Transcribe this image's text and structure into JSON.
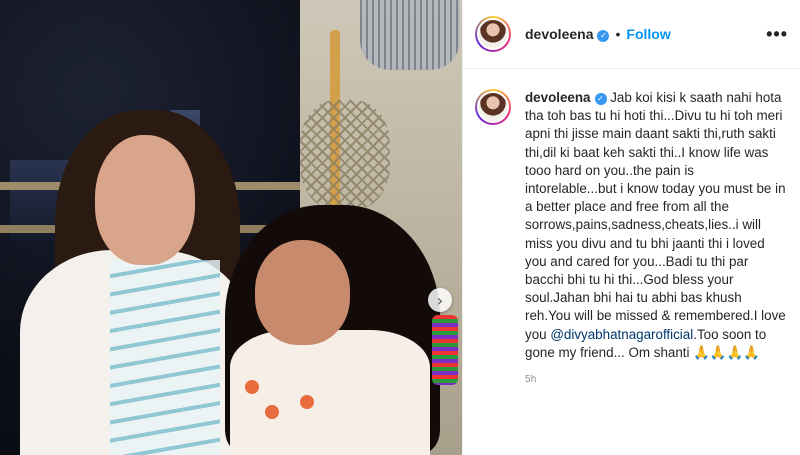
{
  "post": {
    "username": "devoleena",
    "verified_icon": "verified-badge-icon",
    "separator": "•",
    "follow_label": "Follow",
    "more_icon": "more-options-icon",
    "more_label": "•••",
    "carousel_next_label": "›",
    "caption": {
      "username": "devoleena",
      "text": "Jab koi kisi k saath nahi hota tha toh bas tu hi hoti thi...Divu tu hi toh meri apni thi jisse main daant sakti thi,ruth sakti thi,dil ki baat keh sakti thi..I know life was tooo hard on you..the pain is intorelable...but i know today you must be in a better place and free from all the sorrows,pains,sadness,cheats,lies..i will miss you divu and tu bhi jaanti thi i loved you and cared for you...Badi tu thi par bacchi bhi tu hi thi...God bless your soul.Jahan bhi hai tu abhi bas khush reh.You will be missed & remembered.I love you",
      "mention": "@divyabhatnagarofficial",
      "text_after": ".Too soon to gone my friend... Om shanti 🙏🙏🙏🙏"
    },
    "timestamp": "5h"
  },
  "colors": {
    "follow": "#0095f6",
    "verified": "#3897f0",
    "mention": "#00376b",
    "timestamp": "#8e8e8e"
  }
}
